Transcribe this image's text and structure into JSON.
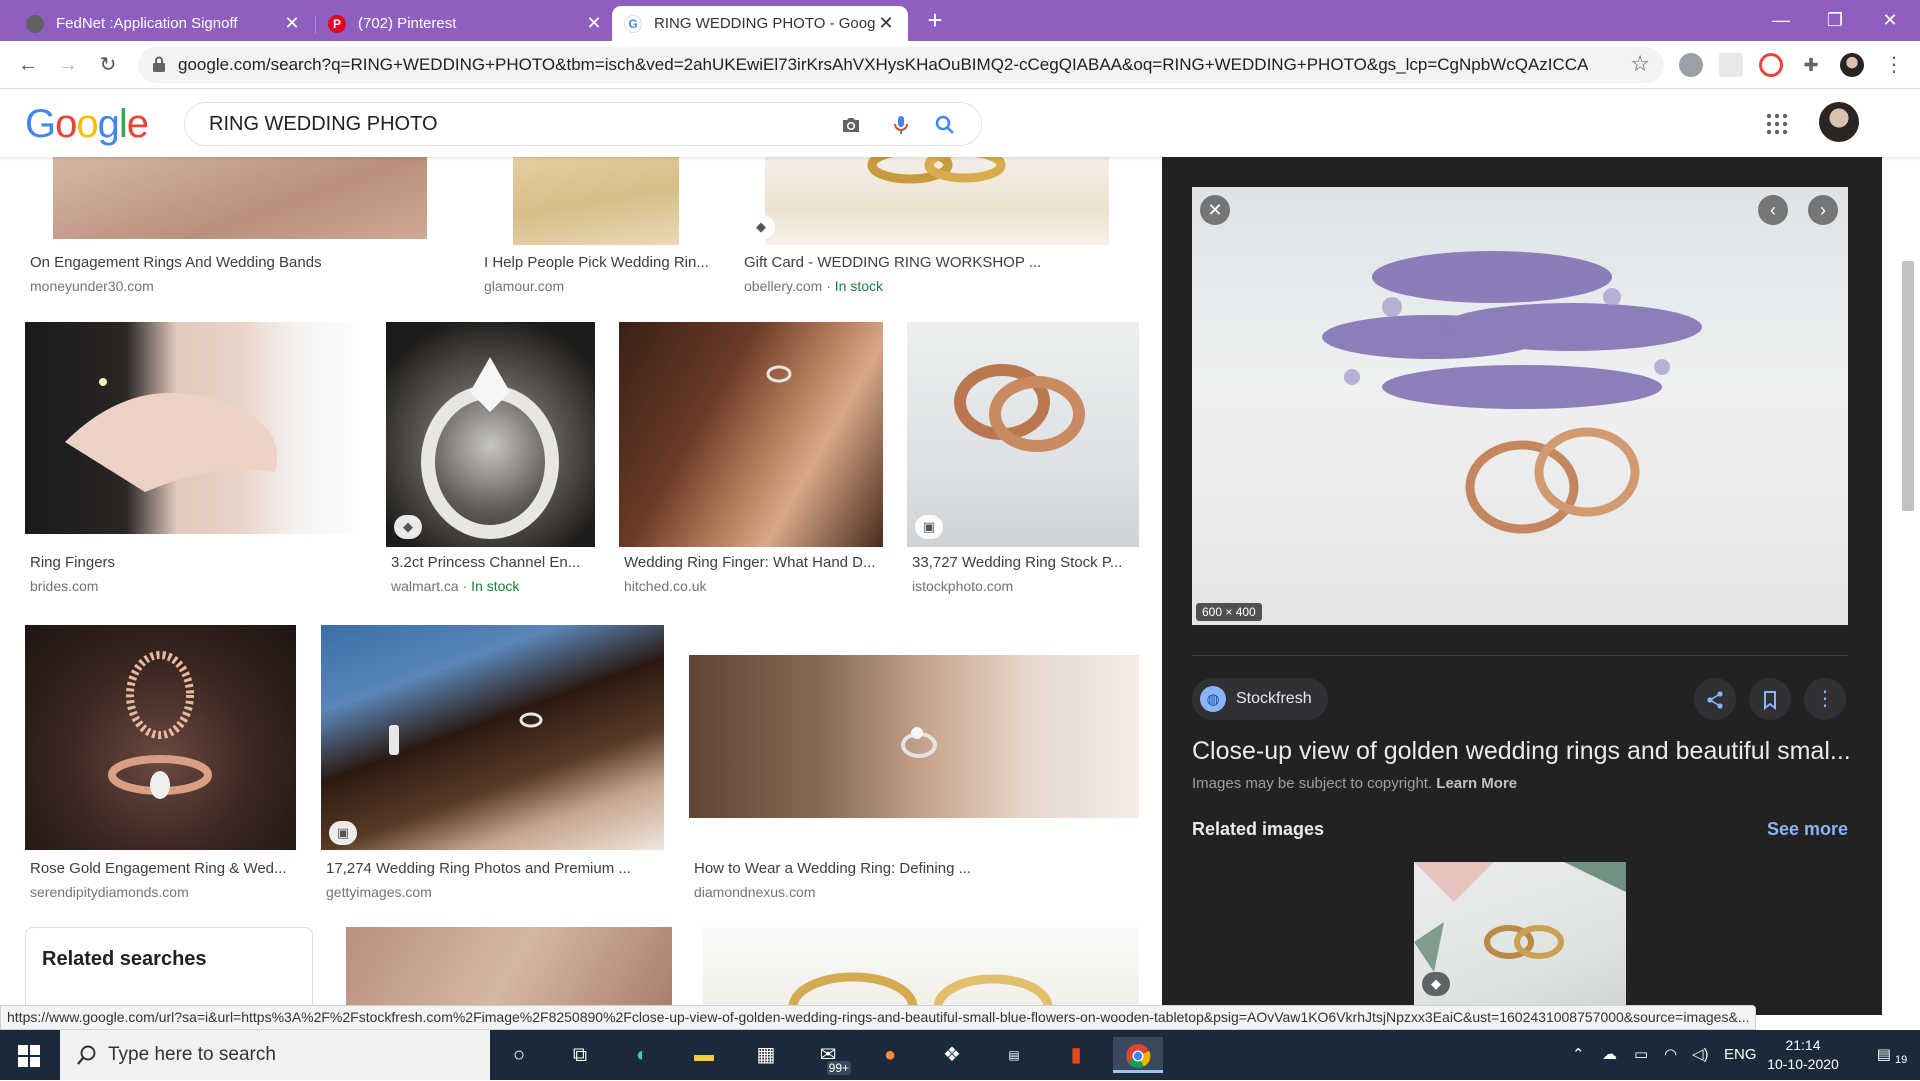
{
  "browser": {
    "tabs": [
      {
        "title": "FedNet :Application Signoff",
        "close": "✕"
      },
      {
        "title": "(702) Pinterest",
        "close": "✕"
      },
      {
        "title": "RING WEDDING PHOTO - Google",
        "close": "✕"
      }
    ],
    "url": "google.com/search?q=RING+WEDDING+PHOTO&tbm=isch&ved=2ahUKEwiEl73irKrsAhVXHysKHaOuBIMQ2-cCegQIABAA&oq=RING+WEDDING+PHOTO&gs_lcp=CgNpbWcQAzICCA..."
  },
  "google": {
    "logo": "Google",
    "query": "RING WEDDING PHOTO"
  },
  "results": {
    "row0": [
      {
        "caption": "On Engagement Rings And Wedding Bands",
        "source": "moneyunder30.com"
      },
      {
        "caption": "I Help People Pick Wedding Rin...",
        "source": "glamour.com"
      },
      {
        "caption": "Gift Card - WEDDING RING WORKSHOP ...",
        "source": "obellery.com",
        "stock": "In stock"
      }
    ],
    "row1": [
      {
        "caption": "Ring Fingers",
        "source": "brides.com"
      },
      {
        "caption": "3.2ct Princess Channel En...",
        "source": "walmart.ca",
        "stock": "In stock"
      },
      {
        "caption": "Wedding Ring Finger: What Hand D...",
        "source": "hitched.co.uk"
      },
      {
        "caption": "33,727 Wedding Ring Stock P...",
        "source": "istockphoto.com"
      }
    ],
    "row2": [
      {
        "caption": "Rose Gold Engagement Ring & Wed...",
        "source": "serendipitydiamonds.com"
      },
      {
        "caption": "17,274 Wedding Ring Photos and Premium ...",
        "source": "gettyimages.com"
      },
      {
        "caption": "How to Wear a Wedding Ring: Defining ...",
        "source": "diamondnexus.com"
      }
    ],
    "related_searches": "Related searches",
    "separator": " · "
  },
  "panel": {
    "dimensions": "600 × 400",
    "source": "Stockfresh",
    "title": "Close-up view of golden wedding rings and beautiful smal...",
    "copyright": "Images may be subject to copyright.",
    "learn_more": "Learn More",
    "related_images": "Related images",
    "see_more": "See more"
  },
  "status_url": "https://www.google.com/url?sa=i&url=https%3A%2F%2Fstockfresh.com%2Fimage%2F8250890%2Fclose-up-view-of-golden-wedding-rings-and-beautiful-small-blue-flowers-on-wooden-tabletop&psig=AOvVaw1KO6VkrhJtsjNpzxx3EaiC&ust=1602431008757000&source=images&...",
  "taskbar": {
    "search_placeholder": "Type here to search",
    "mail_badge": "99+",
    "language": "ENG",
    "time": "21:14",
    "date": "10-10-2020",
    "notifications": "19"
  },
  "colors": {
    "tabbar": "#8e5ec0",
    "panel_bg": "#222222",
    "link_blue": "#8ab4f8",
    "stock_green": "#188038"
  }
}
